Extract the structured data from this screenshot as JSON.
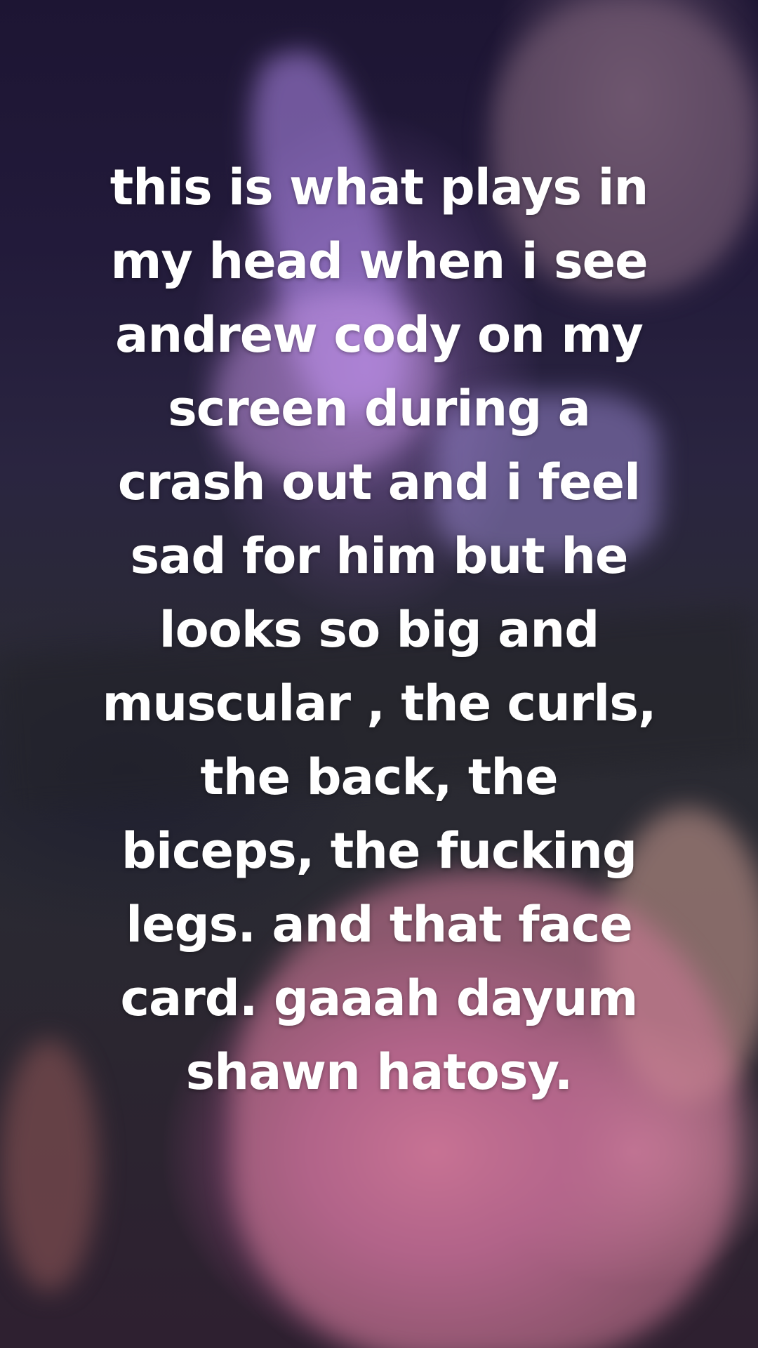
{
  "caption": {
    "lines": [
      "this is what plays in",
      "my head when i see",
      "andrew cody on my",
      "screen during a",
      "crash out and i feel",
      "sad for him but he",
      "looks so big and",
      "muscular , the curls,",
      "the back, the",
      "biceps, the fucking",
      "legs. and that face",
      "card. gaaah dayum",
      "shawn hatosy."
    ]
  }
}
